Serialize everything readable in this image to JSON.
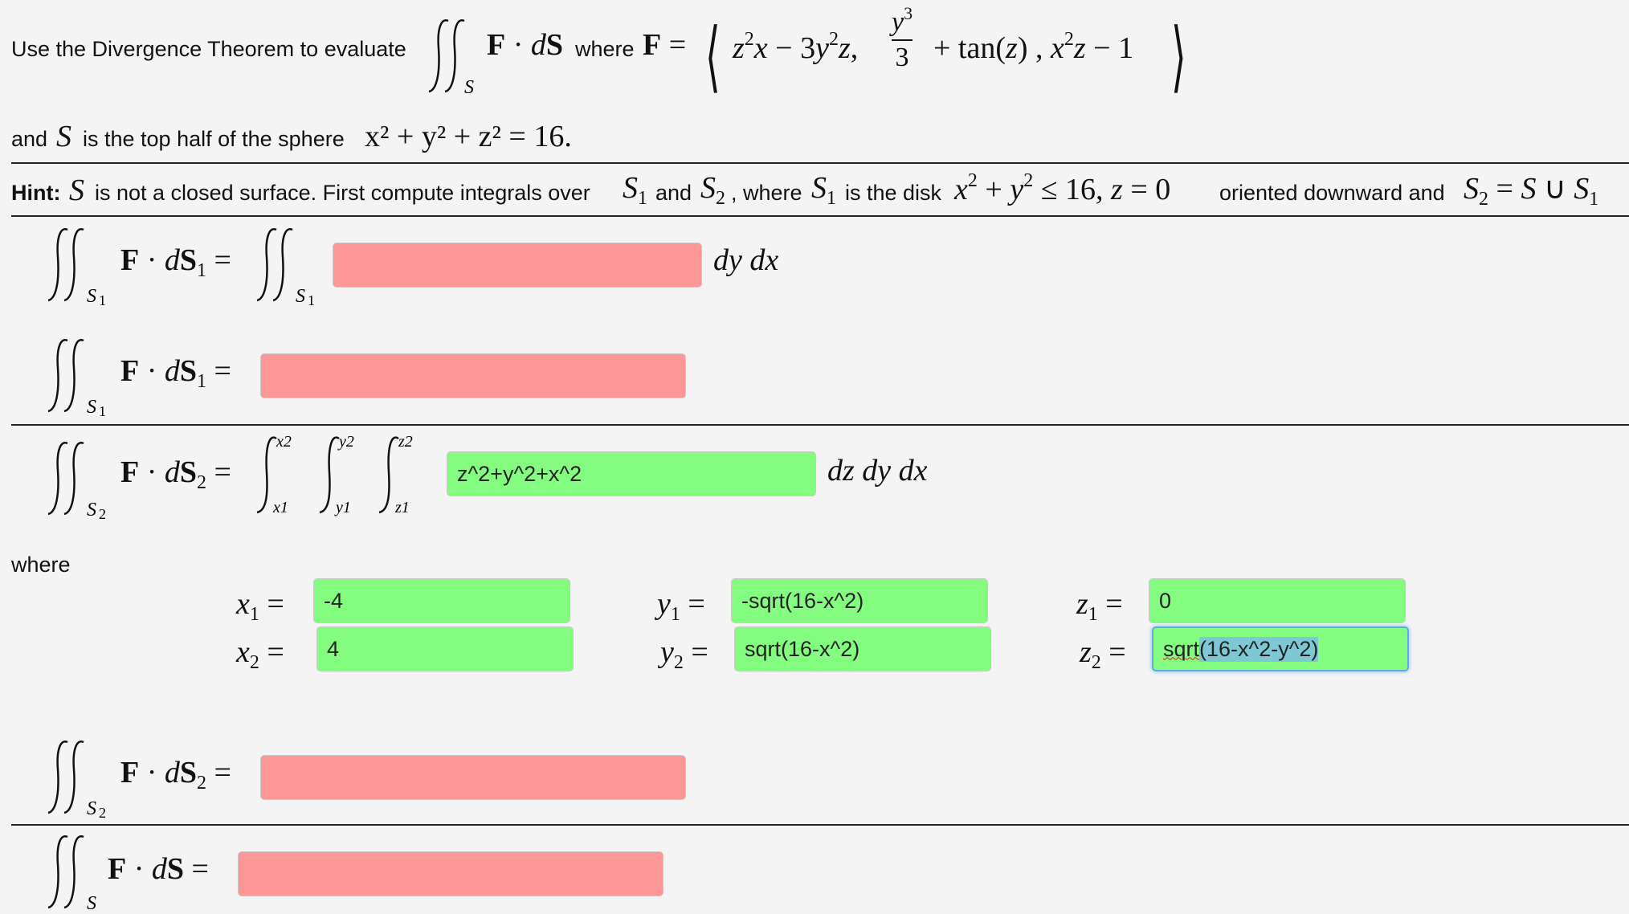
{
  "intro": {
    "lead": "Use the Divergence Theorem to evaluate",
    "where_word": "where",
    "and_word": "and",
    "sphere_text": "is the top half of the sphere",
    "sphere_eq": "x² + y² + z² = 16."
  },
  "hint": {
    "label": "Hint:",
    "t1": "is not a closed surface. First compute integrals over",
    "t2": "and",
    "t3": ", where",
    "t4": "is the disk",
    "t5": "oriented downward and"
  },
  "differentials": {
    "dydx": "dy dx",
    "dzdydx": "dz dy dx"
  },
  "where_label": "where",
  "fields": {
    "s1_integrand": "",
    "s1_value": "",
    "s2_integrand": "z^2+y^2+x^2",
    "x1": "-4",
    "x2": "4",
    "y1": "-sqrt(16-x^2)",
    "y2": "sqrt(16-x^2)",
    "z1": "0",
    "z2_part1": "sqrt",
    "z2_part2": "(16-x^2-y^2)",
    "s2_value": "",
    "s_value": ""
  },
  "colors": {
    "incorrect": "#fd9696",
    "correct": "#83fc7f",
    "focus": "#63a9e8"
  }
}
